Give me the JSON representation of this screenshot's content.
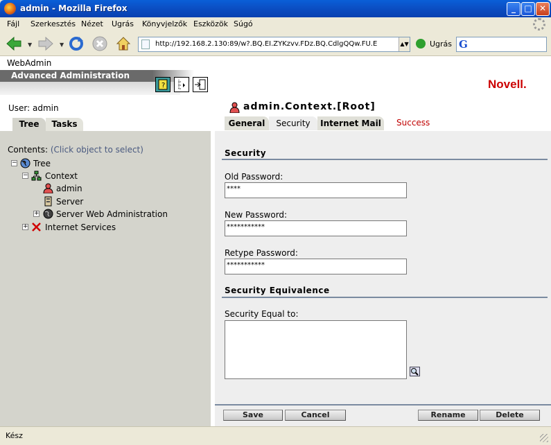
{
  "window": {
    "title": "admin - Mozilla Firefox"
  },
  "menu": {
    "items": [
      "Fájl",
      "Szerkesztés",
      "Nézet",
      "Ugrás",
      "Könyvjelzők",
      "Eszközök",
      "Súgó"
    ]
  },
  "nav": {
    "url": "http://192.168.2.130:89/w?.BQ.EI.ZYKzvv.FDz.BQ.CdlgQQw.FU.E",
    "go_label": "Ugrás",
    "search_value": ""
  },
  "header": {
    "app_name": "WebAdmin",
    "subtitle": "Advanced Administration",
    "brand": "Novell."
  },
  "left": {
    "user_label": "User:  admin",
    "tabs": [
      "Tree",
      "Tasks"
    ],
    "contents_label": "Contents:",
    "contents_hint": "(Click object to select)",
    "tree": {
      "root": "Tree",
      "context": "Context",
      "admin": "admin",
      "server": "Server",
      "swa": "Server Web Administration",
      "internet": "Internet Services"
    }
  },
  "right": {
    "object_title": "admin.Context.[Root]",
    "tabs": [
      "General",
      "Security",
      "Internet Mail"
    ],
    "status": "Success",
    "security_heading": "Security",
    "old_password_label": "Old Password:",
    "old_password_value": "****",
    "new_password_label": "New Password:",
    "new_password_value": "***********",
    "retype_password_label": "Retype Password:",
    "retype_password_value": "***********",
    "equiv_heading": "Security Equivalence",
    "equal_to_label": "Security Equal to:",
    "buttons": {
      "save": "Save",
      "cancel": "Cancel",
      "rename": "Rename",
      "delete": "Delete"
    }
  },
  "status_bar": {
    "text": "Kész"
  },
  "colors": {
    "titlebar": "#0b4fc4",
    "brand_red": "#cc0000",
    "success_red": "#c00000",
    "panel_grey": "#d4d4cc",
    "section_rule": "#7a8aa0"
  }
}
